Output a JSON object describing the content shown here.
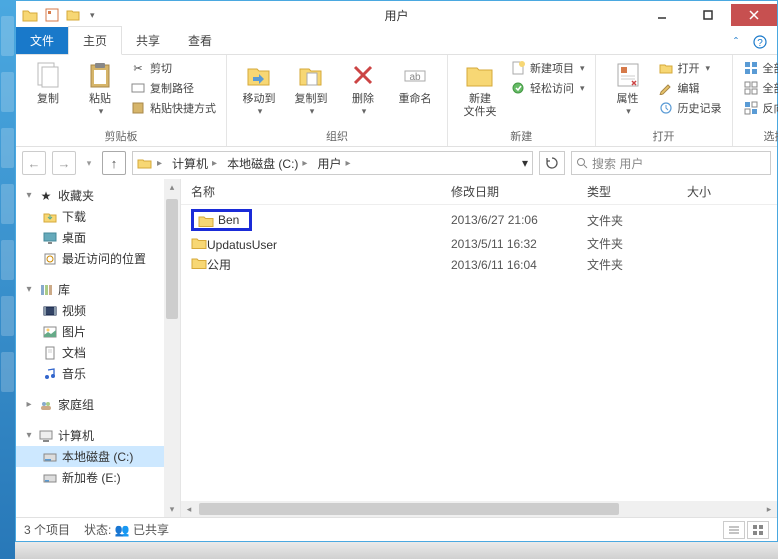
{
  "window": {
    "title": "用户"
  },
  "ribbon_tabs": {
    "file": "文件",
    "home": "主页",
    "share": "共享",
    "view": "查看"
  },
  "ribbon": {
    "clipboard": {
      "copy": "复制",
      "paste": "粘贴",
      "cut": "剪切",
      "copy_path": "复制路径",
      "paste_shortcut": "粘贴快捷方式",
      "label": "剪贴板"
    },
    "organize": {
      "move_to": "移动到",
      "copy_to": "复制到",
      "delete": "删除",
      "rename": "重命名",
      "label": "组织"
    },
    "new": {
      "new_folder_1": "新建",
      "new_folder_2": "文件夹",
      "new_item": "新建项目",
      "easy_access": "轻松访问",
      "label": "新建"
    },
    "open": {
      "properties": "属性",
      "open": "打开",
      "edit": "编辑",
      "history": "历史记录",
      "label": "打开"
    },
    "select": {
      "select_all": "全部选择",
      "select_none": "全部取消",
      "invert": "反向选择",
      "label": "选择"
    }
  },
  "breadcrumb": {
    "segments": [
      "计算机",
      "本地磁盘 (C:)",
      "用户"
    ]
  },
  "search": {
    "placeholder": "搜索 用户"
  },
  "nav": {
    "favorites": {
      "label": "收藏夹",
      "items": [
        "下载",
        "桌面",
        "最近访问的位置"
      ]
    },
    "libraries": {
      "label": "库",
      "items": [
        "视频",
        "图片",
        "文档",
        "音乐"
      ]
    },
    "homegroup": {
      "label": "家庭组"
    },
    "computer": {
      "label": "计算机",
      "items": [
        "本地磁盘 (C:)",
        "新加卷 (E:)"
      ]
    }
  },
  "columns": {
    "name": "名称",
    "date": "修改日期",
    "type": "类型",
    "size": "大小"
  },
  "files": [
    {
      "name": "Ben",
      "date": "2013/6/27 21:06",
      "type": "文件夹",
      "highlighted": true
    },
    {
      "name": "UpdatusUser",
      "date": "2013/5/11 16:32",
      "type": "文件夹",
      "highlighted": false
    },
    {
      "name": "公用",
      "date": "2013/6/11 16:04",
      "type": "文件夹",
      "highlighted": false
    }
  ],
  "status": {
    "count": "3 个项目",
    "state_label": "状态:",
    "state_value": "已共享"
  }
}
